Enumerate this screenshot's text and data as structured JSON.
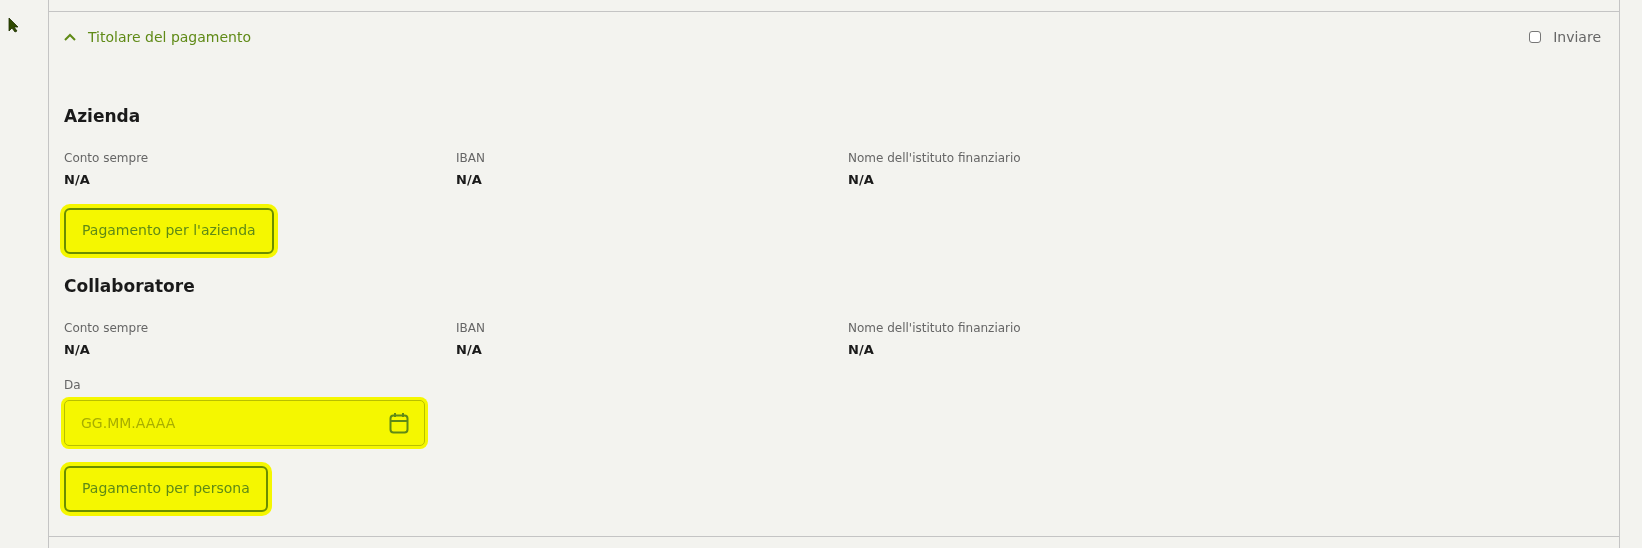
{
  "section": {
    "title": "Titolare del pagamento",
    "expanded": true,
    "send_checkbox": {
      "label": "Inviare",
      "checked": false
    }
  },
  "groups": [
    {
      "heading": "Azienda",
      "fields": [
        {
          "label": "Conto sempre",
          "value": "N/A"
        },
        {
          "label": "IBAN",
          "value": "N/A"
        },
        {
          "label": "Nome dell'istituto finanziario",
          "value": "N/A"
        }
      ],
      "button": "Pagamento per l'azienda"
    },
    {
      "heading": "Collaboratore",
      "fields": [
        {
          "label": "Conto sempre",
          "value": "N/A"
        },
        {
          "label": "IBAN",
          "value": "N/A"
        },
        {
          "label": "Nome dell'istituto finanziario",
          "value": "N/A"
        }
      ],
      "date_field": {
        "label": "Da",
        "placeholder": "GG.MM.AAAA"
      },
      "button": "Pagamento per persona"
    }
  ]
}
